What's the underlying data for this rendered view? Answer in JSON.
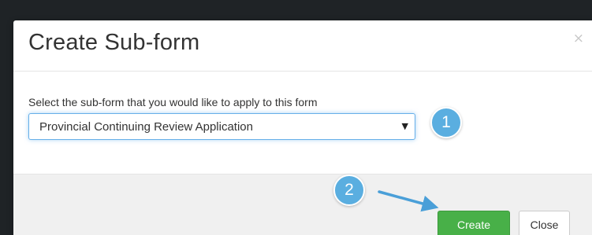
{
  "dialog": {
    "title": "Create Sub-form",
    "close_icon_glyph": "×"
  },
  "form": {
    "label": "Select the sub-form that you would like to apply to this form",
    "selected_value": "Provincial Continuing Review Application",
    "dropdown_arrow": "▼"
  },
  "footer": {
    "create_label": "Create",
    "close_label": "Close"
  },
  "annotations": {
    "step_1": "1",
    "step_2": "2",
    "badge_color": "#5aaee0"
  },
  "colors": {
    "create_button": "#48b048",
    "select_focus": "#66afe9"
  }
}
